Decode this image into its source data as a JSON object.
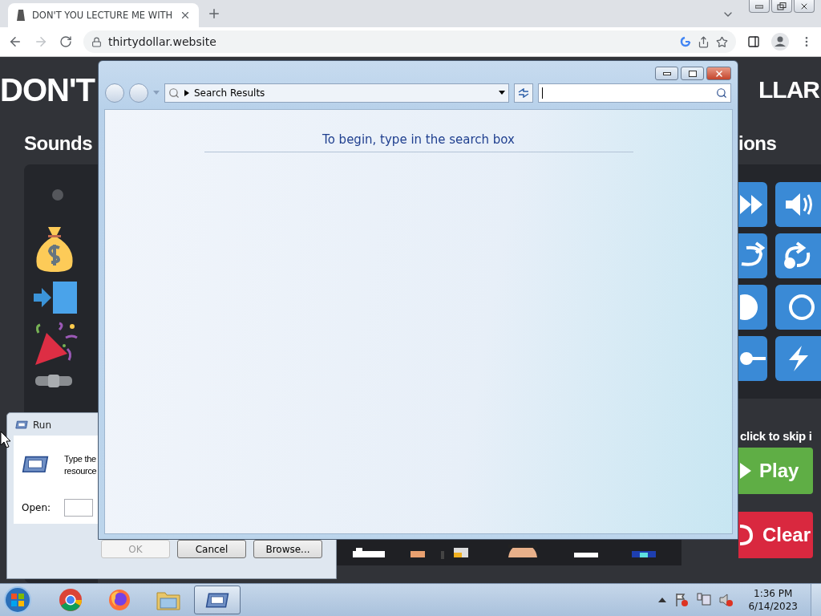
{
  "browser": {
    "tab": {
      "title": "DON'T YOU LECTURE ME WITH"
    },
    "url": "thirtydollar.website"
  },
  "page": {
    "title_left": "DON'T",
    "title_right": "LLAR",
    "sounds_heading": "Sounds",
    "actions_heading": "ions",
    "skip_hint": "click to skip i",
    "play_button": "Play",
    "clear_button": "Clear"
  },
  "run_dialog": {
    "title": "Run",
    "description_lines": [
      "Type the",
      "resource"
    ],
    "open_label": "Open:",
    "buttons": [
      {
        "label": "OK",
        "disabled": true
      },
      {
        "label": "Cancel",
        "disabled": false
      },
      {
        "label": "Browse...",
        "disabled": false
      }
    ]
  },
  "explorer": {
    "address": "Search Results",
    "message": "To begin, type in the search box"
  },
  "taskbar": {
    "items": [
      {
        "kind": "chrome",
        "selected": false
      },
      {
        "kind": "firefox",
        "selected": false
      },
      {
        "kind": "folder",
        "selected": false
      },
      {
        "kind": "run",
        "selected": true
      }
    ],
    "time": "1:36 PM",
    "date": "6/14/2023"
  }
}
